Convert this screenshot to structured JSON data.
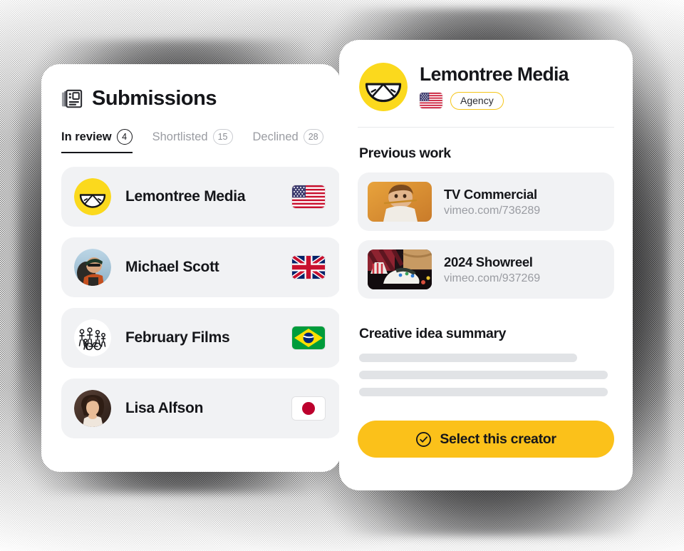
{
  "submissions_panel": {
    "icon": "newspaper-icon",
    "title": "Submissions",
    "tabs": [
      {
        "label": "In review",
        "count": "4",
        "active": true
      },
      {
        "label": "Shortlisted",
        "count": "15",
        "active": false
      },
      {
        "label": "Declined",
        "count": "28",
        "active": false
      }
    ],
    "rows": [
      {
        "name": "Lemontree Media",
        "avatar": "lemon-logo-avatar",
        "flag": "flag-us",
        "flag_name": "united-states-flag"
      },
      {
        "name": "Michael Scott",
        "avatar": "photo-avatar-man-cap",
        "flag": "flag-gb",
        "flag_name": "united-kingdom-flag"
      },
      {
        "name": "February Films",
        "avatar": "line-art-avatar-crowd",
        "flag": "flag-br",
        "flag_name": "brazil-flag"
      },
      {
        "name": "Lisa Alfson",
        "avatar": "photo-avatar-woman",
        "flag": "flag-jp",
        "flag_name": "japan-flag"
      }
    ]
  },
  "detail_panel": {
    "avatar": "lemon-logo-avatar",
    "name": "Lemontree Media",
    "flag": "flag-us",
    "flag_name": "united-states-flag",
    "badge": "Agency",
    "previous_work_title": "Previous work",
    "works": [
      {
        "title": "TV Commercial",
        "url": "vimeo.com/736289",
        "thumb": "thumb-child-yellow"
      },
      {
        "title": "2024 Showreel",
        "url": "vimeo.com/937269",
        "thumb": "thumb-sneaker-popcorn"
      }
    ],
    "creative_idea_title": "Creative idea summary",
    "summary_placeholder_widths": [
      "86%",
      "98%",
      "98%"
    ],
    "cta": {
      "label": "Select this creator",
      "icon": "check-circle-icon"
    }
  },
  "colors": {
    "brand_yellow": "#FBC11A",
    "badge_border": "#F5C518",
    "row_background": "#F1F2F4",
    "text_primary": "#15161A",
    "text_muted": "#9A9CA2",
    "skeleton": "#E1E3E6"
  }
}
